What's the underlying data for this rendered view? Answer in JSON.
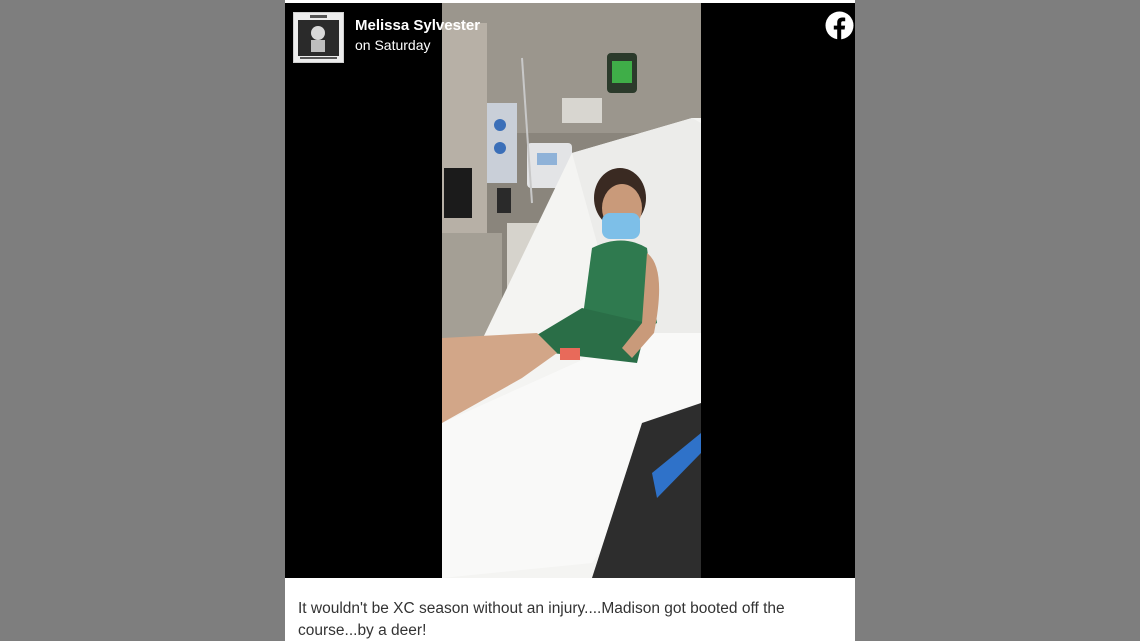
{
  "post": {
    "author_name": "Melissa Sylvester",
    "timestamp": "on Saturday",
    "caption": "It wouldn't be XC season without an injury....Madison got booted off the course...by a deer!",
    "avatar_icon": "profile-picture",
    "platform_icon": "facebook-icon",
    "media_icon": "photo"
  },
  "colors": {
    "facebook_brand": "#ffffff",
    "media_background": "#000000",
    "page_background": "#7e7e7e",
    "caption_text": "#333333"
  }
}
